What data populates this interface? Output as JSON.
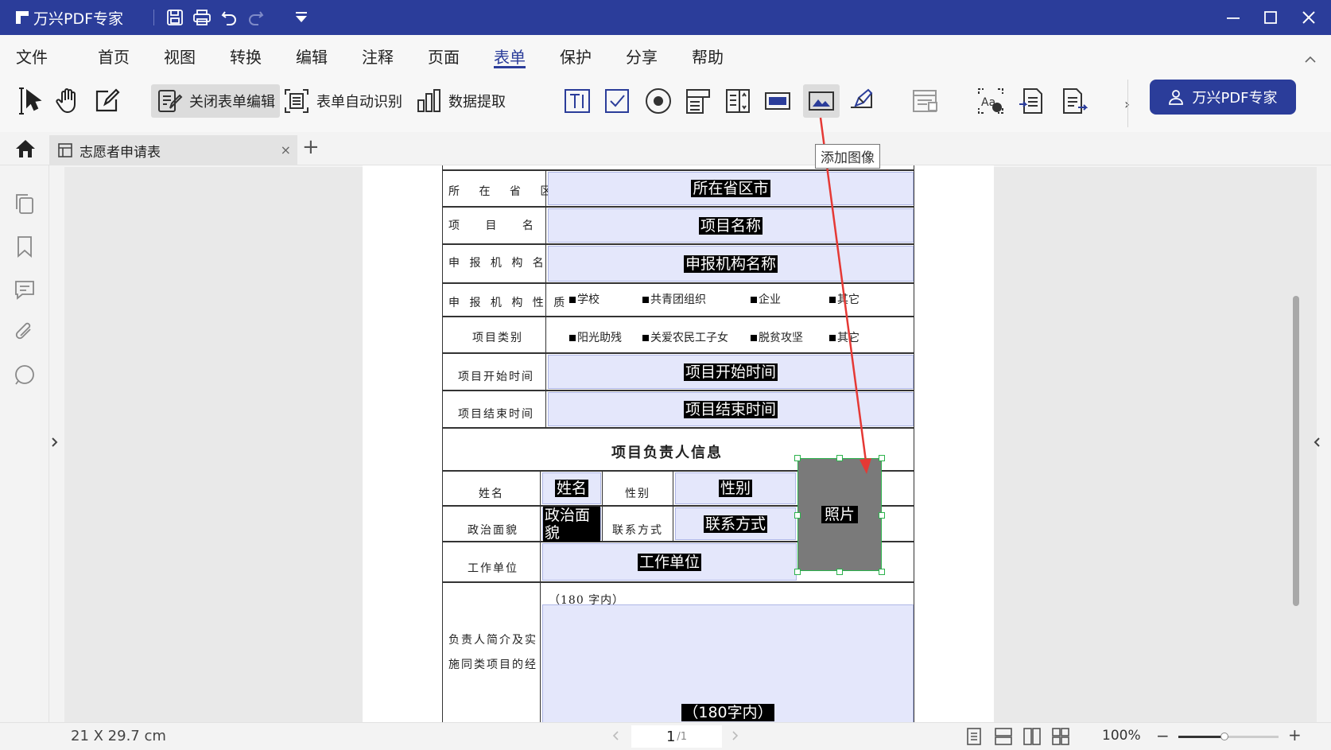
{
  "app": {
    "title": "万兴PDF专家"
  },
  "menu": [
    "文件",
    "首页",
    "视图",
    "转换",
    "编辑",
    "注释",
    "页面",
    "表单",
    "保护",
    "分享",
    "帮助"
  ],
  "active_menu": "表单",
  "toolbar": {
    "close_form_edit": "关闭表单编辑",
    "auto_recognize": "表单自动识别",
    "data_extract": "数据提取",
    "more": "›"
  },
  "premium": {
    "label": "万兴PDF专家"
  },
  "tab": {
    "title": "志愿者申请表",
    "close": "×",
    "add": "+"
  },
  "tooltip": "添加图像",
  "form": {
    "rows": {
      "province_label": "所 在 省 区 市",
      "province_field": "所在省区市",
      "project_label": "项 目 名 称",
      "project_field": "项目名称",
      "org_label": "申 报 机 构 名 称",
      "org_field": "申报机构名称",
      "nature_label": "申 报 机 构 性 质",
      "nature_options": [
        "学校",
        "共青团组织",
        "企业",
        "其它"
      ],
      "category_label": "项目类别",
      "category_options": [
        "阳光助残",
        "关爱农民工子女",
        "脱贫攻坚",
        "其它"
      ],
      "start_label": "项目开始时间",
      "start_field": "项目开始时间",
      "end_label": "项目结束时间",
      "end_field": "项目结束时间"
    },
    "section_title": "项目负责人信息",
    "person": {
      "name_label": "姓名",
      "name_field": "姓名",
      "gender_label": "性别",
      "gender_field": "性别",
      "political_label": "政治面貌",
      "political_field": "政治面貌",
      "contact_label": "联系方式",
      "contact_field": "联系方式",
      "work_label": "工作单位",
      "work_field": "工作单位",
      "photo_field": "照片",
      "intro_label_1": "负责人简介及实",
      "intro_label_2": "施同类项目的经",
      "intro_hint": "（180 字内）",
      "intro_field": "（180字内）"
    }
  },
  "status": {
    "page_size": "21 X 29.7 cm",
    "page_current": "1",
    "page_total": "/1",
    "zoom": "100%",
    "zoom_level": 0.46
  },
  "colors": {
    "brand": "#2b3d9a",
    "field_bg": "#e4e7fb",
    "arrow": "#e53935",
    "selection": "#2bb24c"
  }
}
